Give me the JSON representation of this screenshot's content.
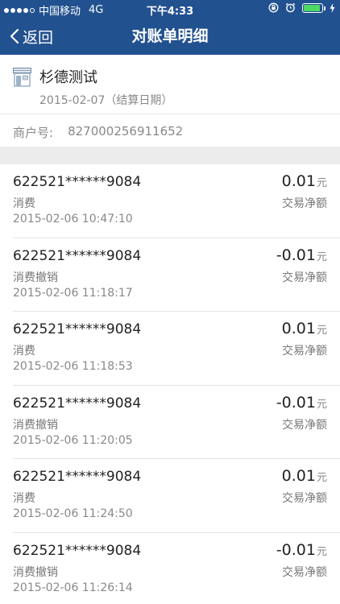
{
  "status_bar": {
    "carrier": "中国移动",
    "network": "4G",
    "time": "下午4:33",
    "battery_level": 0.9
  },
  "navbar": {
    "back_label": "返回",
    "title": "对账单明细"
  },
  "merchant": {
    "name": "杉德测试",
    "date": "2015-02-07（结算日期）",
    "id_label": "商户号:",
    "id_value": "827000256911652"
  },
  "transactions": [
    {
      "card": "622521******9084",
      "type": "消费",
      "time": "2015-02-06 10:47:10",
      "amount": "0.01",
      "unit": "元",
      "amount_label": "交易净额"
    },
    {
      "card": "622521******9084",
      "type": "消费撤销",
      "time": "2015-02-06 11:18:17",
      "amount": "-0.01",
      "unit": "元",
      "amount_label": "交易净额"
    },
    {
      "card": "622521******9084",
      "type": "消费",
      "time": "2015-02-06 11:18:53",
      "amount": "0.01",
      "unit": "元",
      "amount_label": "交易净额"
    },
    {
      "card": "622521******9084",
      "type": "消费撤销",
      "time": "2015-02-06 11:20:05",
      "amount": "-0.01",
      "unit": "元",
      "amount_label": "交易净额"
    },
    {
      "card": "622521******9084",
      "type": "消费",
      "time": "2015-02-06 11:24:50",
      "amount": "0.01",
      "unit": "元",
      "amount_label": "交易净额"
    },
    {
      "card": "622521******9084",
      "type": "消费撤销",
      "time": "2015-02-06 11:26:14",
      "amount": "-0.01",
      "unit": "元",
      "amount_label": "交易净额"
    }
  ],
  "colors": {
    "header_bg": "#22518f",
    "battery": "#4cd964",
    "section_gap": "#ececec"
  }
}
